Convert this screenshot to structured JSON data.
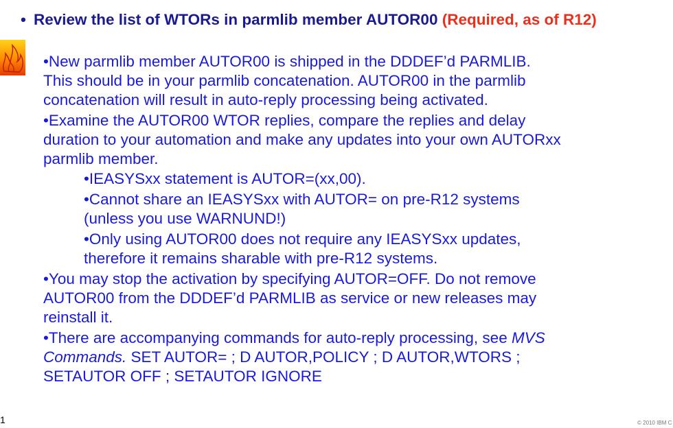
{
  "heading": {
    "bullet": "•",
    "main": "Review the list of WTORs in parmlib member AUTOR00 ",
    "required": "(Required, as of R12)"
  },
  "icons": {
    "flame": "flame-icon"
  },
  "colors": {
    "heading": "#1b1b8f",
    "required": "#e8301f",
    "body": "#1a1ad6"
  },
  "lines": [
    "•New parmlib member AUTOR00 is shipped in the DDDEF’d PARMLIB.",
    "This should be in your parmlib concatenation. AUTOR00 in the parmlib",
    "concatenation will result in auto-reply processing being activated.",
    "•Examine the AUTOR00 WTOR replies, compare the replies and delay",
    "duration to your automation and make any updates into your own AUTORxx",
    "parmlib member.",
    "•IEASYSxx statement is AUTOR=(xx,00).",
    "•Cannot share an IEASYSxx with AUTOR= on pre-R12 systems",
    "(unless you use WARNUND!)",
    "•Only using AUTOR00 does not require any IEASYSxx updates,",
    "therefore it remains sharable with pre-R12 systems.",
    "•You may stop the activation by specifying AUTOR=OFF.  Do not remove",
    "AUTOR00 from the DDDEF’d PARMLIB as service or new releases may",
    "reinstall it.",
    "•There are accompanying commands for auto-reply processing, see ",
    "MVS",
    "Commands.",
    "  SET AUTOR= ; D AUTOR,POLICY ; D AUTOR,WTORS ;",
    "SETAUTOR OFF ; SETAUTOR IGNORE"
  ],
  "footer": {
    "page_number": "1",
    "copyright": "© 2010 IBM C"
  }
}
